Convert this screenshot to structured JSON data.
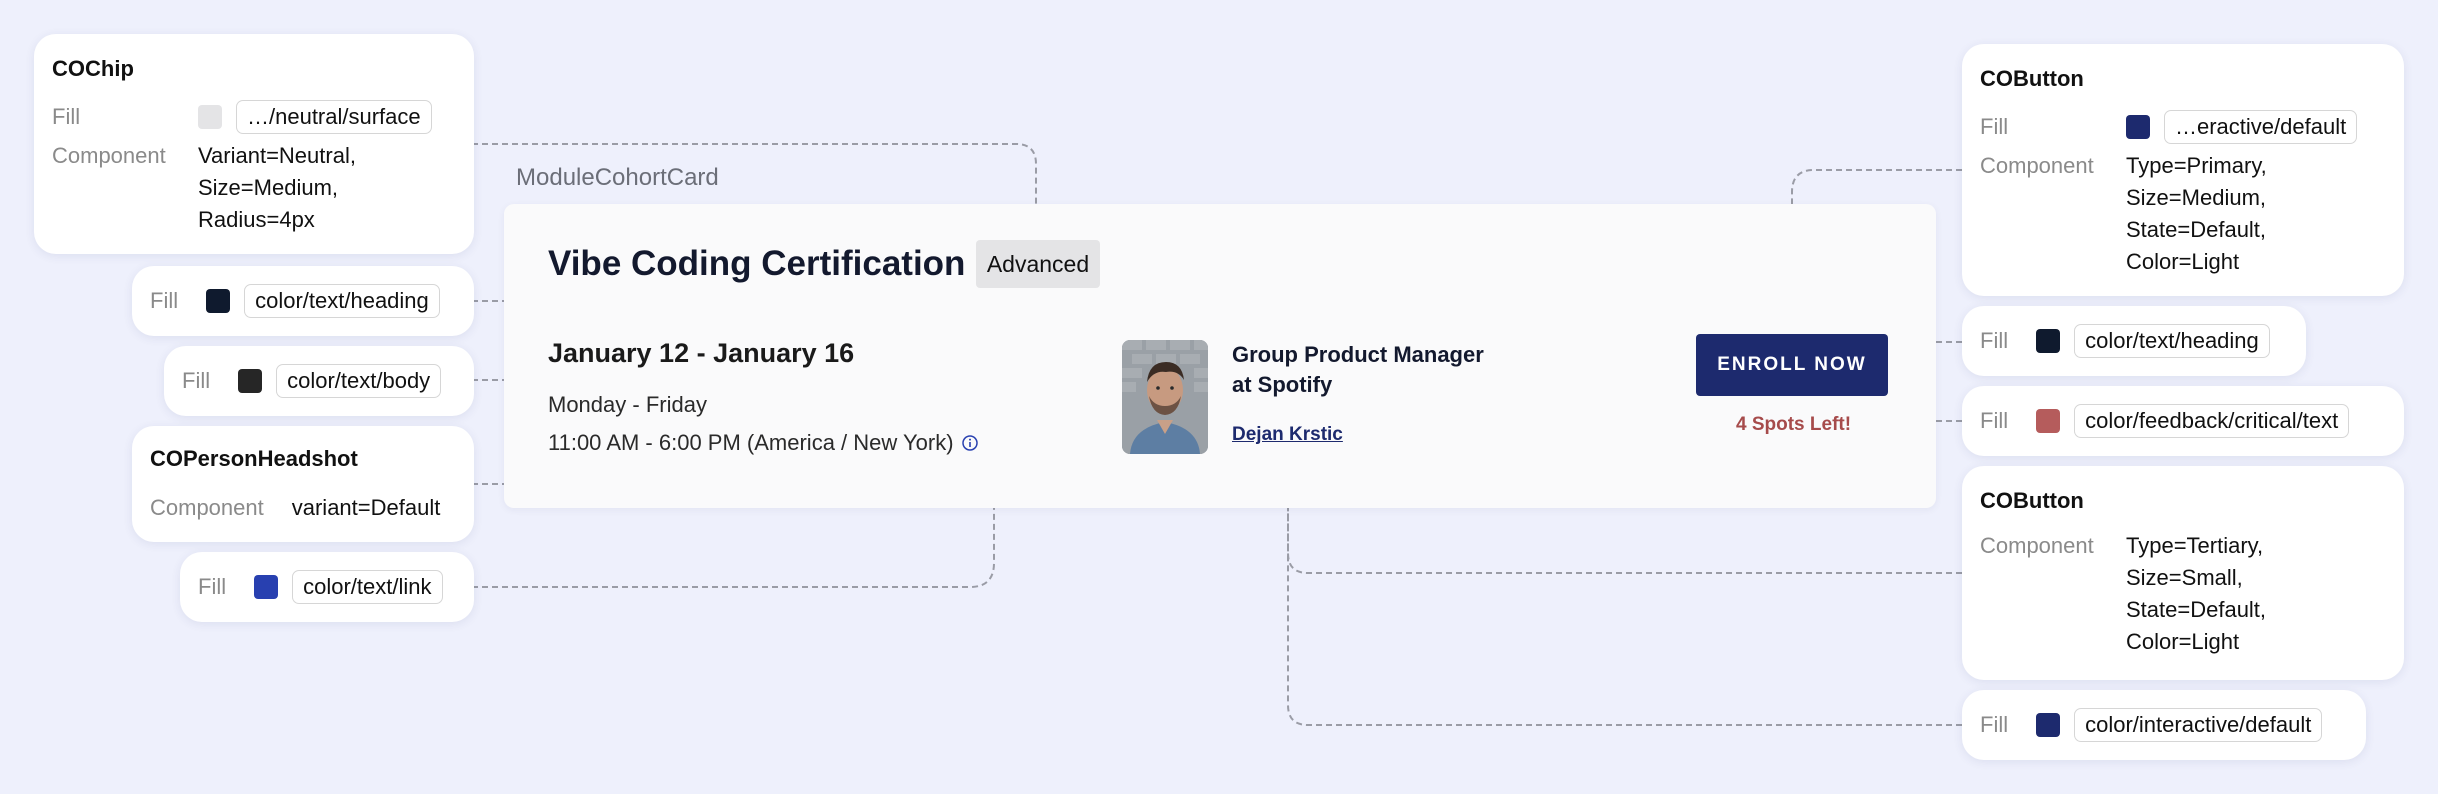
{
  "card": {
    "label": "ModuleCohortCard",
    "title": "Vibe Coding Certification",
    "chip": "Advanced",
    "dates": "January 12 - January 16",
    "days": "Monday - Friday",
    "time": "11:00 AM - 6:00 PM (America / New York)",
    "person_role": "Group Product Manager\nat Spotify",
    "person_name": "Dejan Krstic",
    "enroll_label": "ENROLL NOW",
    "spots": "4 Spots Left!"
  },
  "annotations": {
    "chip": {
      "title": "COChip",
      "fill_label": "Fill",
      "fill_token": "…/neutral/surface",
      "fill_color": "#e4e4e6",
      "component_label": "Component",
      "component_value": "Variant=Neutral,\nSize=Medium,\nRadius=4px"
    },
    "heading_fill": {
      "label": "Fill",
      "token": "color/text/heading",
      "color": "#0f1a2e"
    },
    "body_fill": {
      "label": "Fill",
      "token": "color/text/body",
      "color": "#262626"
    },
    "headshot": {
      "title": "COPersonHeadshot",
      "component_label": "Component",
      "component_value": "variant=Default"
    },
    "link_fill": {
      "label": "Fill",
      "token": "color/text/link",
      "color": "#2840b0"
    },
    "button_primary": {
      "title": "COButton",
      "fill_label": "Fill",
      "fill_token": "…eractive/default",
      "fill_color": "#1d2a6e",
      "component_label": "Component",
      "component_value": "Type=Primary,\nSize=Medium,\nState=Default,\nColor=Light"
    },
    "heading_fill_right": {
      "label": "Fill",
      "token": "color/text/heading",
      "color": "#0f1a2e"
    },
    "critical_fill": {
      "label": "Fill",
      "token": "color/feedback/critical/text",
      "color": "#b55c5c"
    },
    "button_tertiary": {
      "title": "COButton",
      "component_label": "Component",
      "component_value": "Type=Tertiary,\nSize=Small,\nState=Default,\nColor=Light"
    },
    "interactive_fill": {
      "label": "Fill",
      "token": "color/interactive/default",
      "color": "#1d2a6e"
    }
  }
}
